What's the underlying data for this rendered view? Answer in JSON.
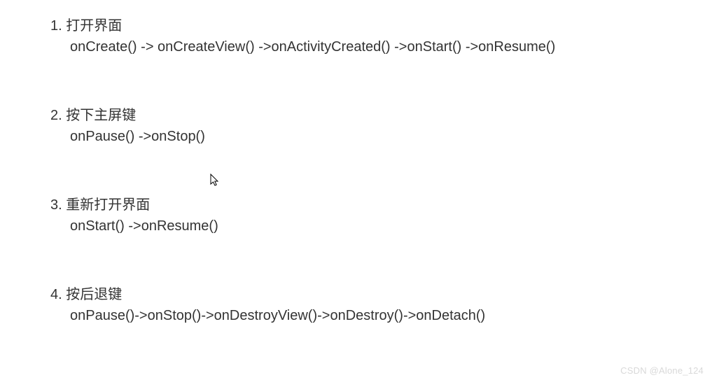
{
  "items": [
    {
      "number": "1. ",
      "title": "打开界面",
      "detail": "onCreate() -> onCreateView() ->onActivityCreated() ->onStart() ->onResume()"
    },
    {
      "number": "2. ",
      "title": "按下主屏键",
      "detail": "onPause() ->onStop()"
    },
    {
      "number": "3. ",
      "title": "重新打开界面",
      "detail": "onStart() ->onResume()"
    },
    {
      "number": "4. ",
      "title": "按后退键",
      "detail": "onPause()->onStop()->onDestroyView()->onDestroy()->onDetach()"
    }
  ],
  "watermark": "CSDN @Alone_124"
}
